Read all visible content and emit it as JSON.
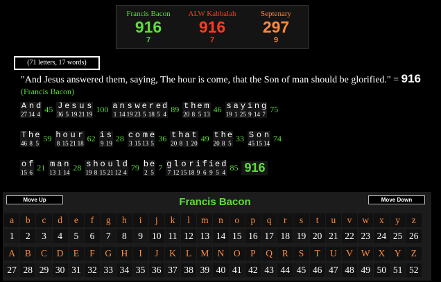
{
  "ciphers": [
    {
      "name": "Francis Bacon",
      "value": "916",
      "reduced": "7",
      "color": "#5dde3a",
      "redcolor": "#5dde3a"
    },
    {
      "name": "ALW Kabbalah",
      "value": "916",
      "reduced": "7",
      "color": "#ff3b1f",
      "redcolor": "#ff3b1f"
    },
    {
      "name": "Septenary",
      "value": "297",
      "reduced": "9",
      "color": "#ff8a3a",
      "redcolor": "#ff8a3a"
    }
  ],
  "count_text": "(71 letters, 17 words)",
  "phrase": "\"And Jesus answered them, saying, The hour is come, that the Son of man should be glorified.\" = ",
  "phrase_total": "916",
  "phrase_cipher": "(Francis Bacon)",
  "rows": [
    [
      {
        "letters": [
          [
            "A",
            "27"
          ],
          [
            "n",
            "14"
          ],
          [
            "d",
            "4"
          ]
        ],
        "sum": "45"
      },
      {
        "letters": [
          [
            "J",
            "36"
          ],
          [
            "e",
            "5"
          ],
          [
            "s",
            "19"
          ],
          [
            "u",
            "21"
          ],
          [
            "s",
            "19"
          ]
        ],
        "sum": "100"
      },
      {
        "letters": [
          [
            "a",
            "1"
          ],
          [
            "n",
            "14"
          ],
          [
            "s",
            "19"
          ],
          [
            "w",
            "23"
          ],
          [
            "e",
            "5"
          ],
          [
            "r",
            "18"
          ],
          [
            "e",
            "5"
          ],
          [
            "d",
            "4"
          ]
        ],
        "sum": "89"
      },
      {
        "letters": [
          [
            "t",
            "20"
          ],
          [
            "h",
            "8"
          ],
          [
            "e",
            "5"
          ],
          [
            "m",
            "13"
          ]
        ],
        "sum": "46"
      },
      {
        "letters": [
          [
            "s",
            "19"
          ],
          [
            "a",
            "1"
          ],
          [
            "y",
            "25"
          ],
          [
            "i",
            "9"
          ],
          [
            "n",
            "14"
          ],
          [
            "g",
            "7"
          ]
        ],
        "sum": "75"
      }
    ],
    [
      {
        "letters": [
          [
            "T",
            "46"
          ],
          [
            "h",
            "8"
          ],
          [
            "e",
            "5"
          ]
        ],
        "sum": "59"
      },
      {
        "letters": [
          [
            "h",
            "8"
          ],
          [
            "o",
            "15"
          ],
          [
            "u",
            "21"
          ],
          [
            "r",
            "18"
          ]
        ],
        "sum": "62"
      },
      {
        "letters": [
          [
            "i",
            "9"
          ],
          [
            "s",
            "19"
          ]
        ],
        "sum": "28"
      },
      {
        "letters": [
          [
            "c",
            "3"
          ],
          [
            "o",
            "15"
          ],
          [
            "m",
            "13"
          ],
          [
            "e",
            "5"
          ]
        ],
        "sum": "36"
      },
      {
        "letters": [
          [
            "t",
            "20"
          ],
          [
            "h",
            "8"
          ],
          [
            "a",
            "1"
          ],
          [
            "t",
            "20"
          ]
        ],
        "sum": "49"
      },
      {
        "letters": [
          [
            "t",
            "20"
          ],
          [
            "h",
            "8"
          ],
          [
            "e",
            "5"
          ]
        ],
        "sum": "33"
      },
      {
        "letters": [
          [
            "S",
            "45"
          ],
          [
            "o",
            "15"
          ],
          [
            "n",
            "14"
          ]
        ],
        "sum": "74"
      }
    ],
    [
      {
        "letters": [
          [
            "o",
            "15"
          ],
          [
            "f",
            "6"
          ]
        ],
        "sum": "21"
      },
      {
        "letters": [
          [
            "m",
            "13"
          ],
          [
            "a",
            "1"
          ],
          [
            "n",
            "14"
          ]
        ],
        "sum": "28"
      },
      {
        "letters": [
          [
            "s",
            "19"
          ],
          [
            "h",
            "8"
          ],
          [
            "o",
            "15"
          ],
          [
            "u",
            "21"
          ],
          [
            "l",
            "12"
          ],
          [
            "d",
            "4"
          ]
        ],
        "sum": "79"
      },
      {
        "letters": [
          [
            "b",
            "2"
          ],
          [
            "e",
            "5"
          ]
        ],
        "sum": "7"
      },
      {
        "letters": [
          [
            "g",
            "7"
          ],
          [
            "l",
            "12"
          ],
          [
            "o",
            "15"
          ],
          [
            "r",
            "18"
          ],
          [
            "i",
            "9"
          ],
          [
            "f",
            "6"
          ],
          [
            "i",
            "9"
          ],
          [
            "e",
            "5"
          ],
          [
            "d",
            "4"
          ]
        ],
        "sum": "85"
      }
    ]
  ],
  "grand_total": "916",
  "panel": {
    "move_up": "Move Up",
    "move_down": "Move Down",
    "title": "Francis Bacon",
    "lower": [
      "a",
      "b",
      "c",
      "d",
      "e",
      "f",
      "g",
      "h",
      "i",
      "j",
      "k",
      "l",
      "m",
      "n",
      "o",
      "p",
      "q",
      "r",
      "s",
      "t",
      "u",
      "v",
      "w",
      "x",
      "y",
      "z"
    ],
    "lower_vals": [
      "1",
      "2",
      "3",
      "4",
      "5",
      "6",
      "7",
      "8",
      "9",
      "10",
      "11",
      "12",
      "13",
      "14",
      "15",
      "16",
      "17",
      "18",
      "19",
      "20",
      "21",
      "22",
      "23",
      "24",
      "25",
      "26"
    ],
    "upper": [
      "A",
      "B",
      "C",
      "D",
      "E",
      "F",
      "G",
      "H",
      "I",
      "J",
      "K",
      "L",
      "M",
      "N",
      "O",
      "P",
      "Q",
      "R",
      "S",
      "T",
      "U",
      "V",
      "W",
      "X",
      "Y",
      "Z"
    ],
    "upper_vals": [
      "27",
      "28",
      "29",
      "30",
      "31",
      "32",
      "33",
      "34",
      "35",
      "36",
      "37",
      "38",
      "39",
      "40",
      "41",
      "42",
      "43",
      "44",
      "45",
      "46",
      "47",
      "48",
      "49",
      "50",
      "51",
      "52"
    ]
  },
  "colors": {
    "accent": "#5dde3a",
    "letter": "#ff8a3a"
  }
}
